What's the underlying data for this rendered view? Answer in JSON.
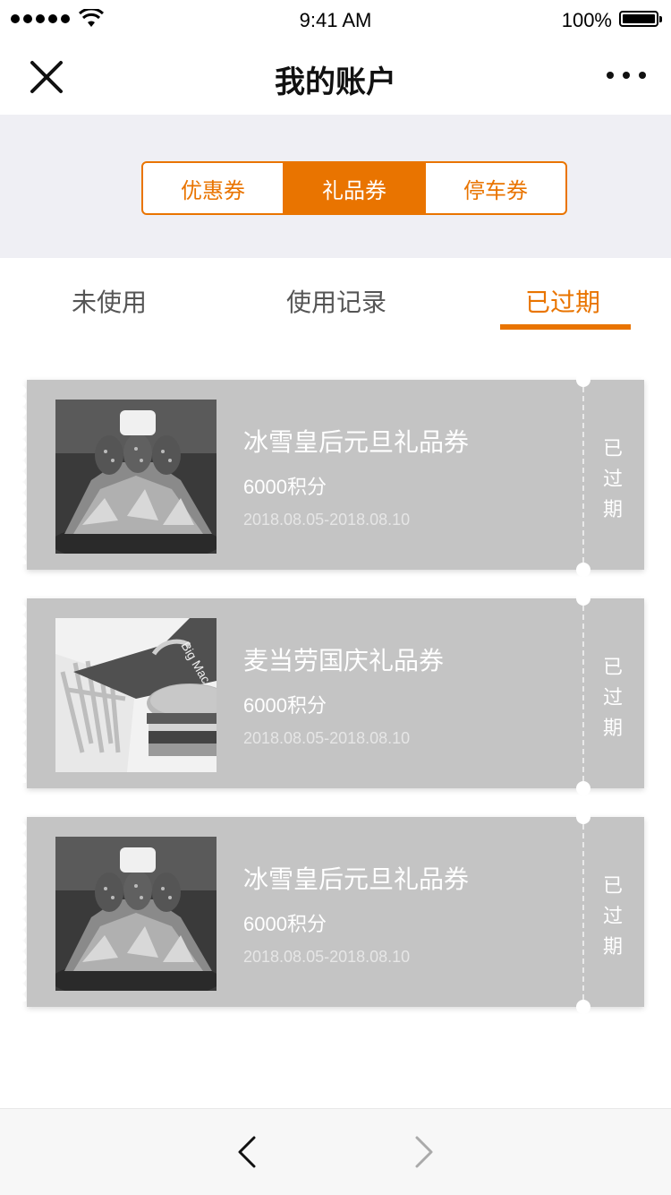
{
  "status_bar": {
    "time": "9:41 AM",
    "battery": "100%"
  },
  "nav": {
    "title": "我的账户"
  },
  "segments": [
    {
      "label": "优惠券",
      "active": false
    },
    {
      "label": "礼品券",
      "active": true
    },
    {
      "label": "停车券",
      "active": false
    }
  ],
  "subtabs": [
    {
      "label": "未使用",
      "active": false
    },
    {
      "label": "使用记录",
      "active": false
    },
    {
      "label": "已过期",
      "active": true
    }
  ],
  "coupons": [
    {
      "title": "冰雪皇后元旦礼品券",
      "points": "6000积分",
      "date": "2018.08.05-2018.08.10",
      "status": "已过期",
      "image": "dessert-image"
    },
    {
      "title": "麦当劳国庆礼品券",
      "points": "6000积分",
      "date": "2018.08.05-2018.08.10",
      "status": "已过期",
      "image": "burger-fries-image"
    },
    {
      "title": "冰雪皇后元旦礼品券",
      "points": "6000积分",
      "date": "2018.08.05-2018.08.10",
      "status": "已过期",
      "image": "dessert-image"
    }
  ],
  "colors": {
    "accent": "#e97400",
    "coupon_bg": "#c4c4c4",
    "page_bg": "#efeff4"
  },
  "icons": {
    "close": "close-icon",
    "more": "more-icon",
    "back": "chevron-left-icon",
    "forward": "chevron-right-icon"
  }
}
